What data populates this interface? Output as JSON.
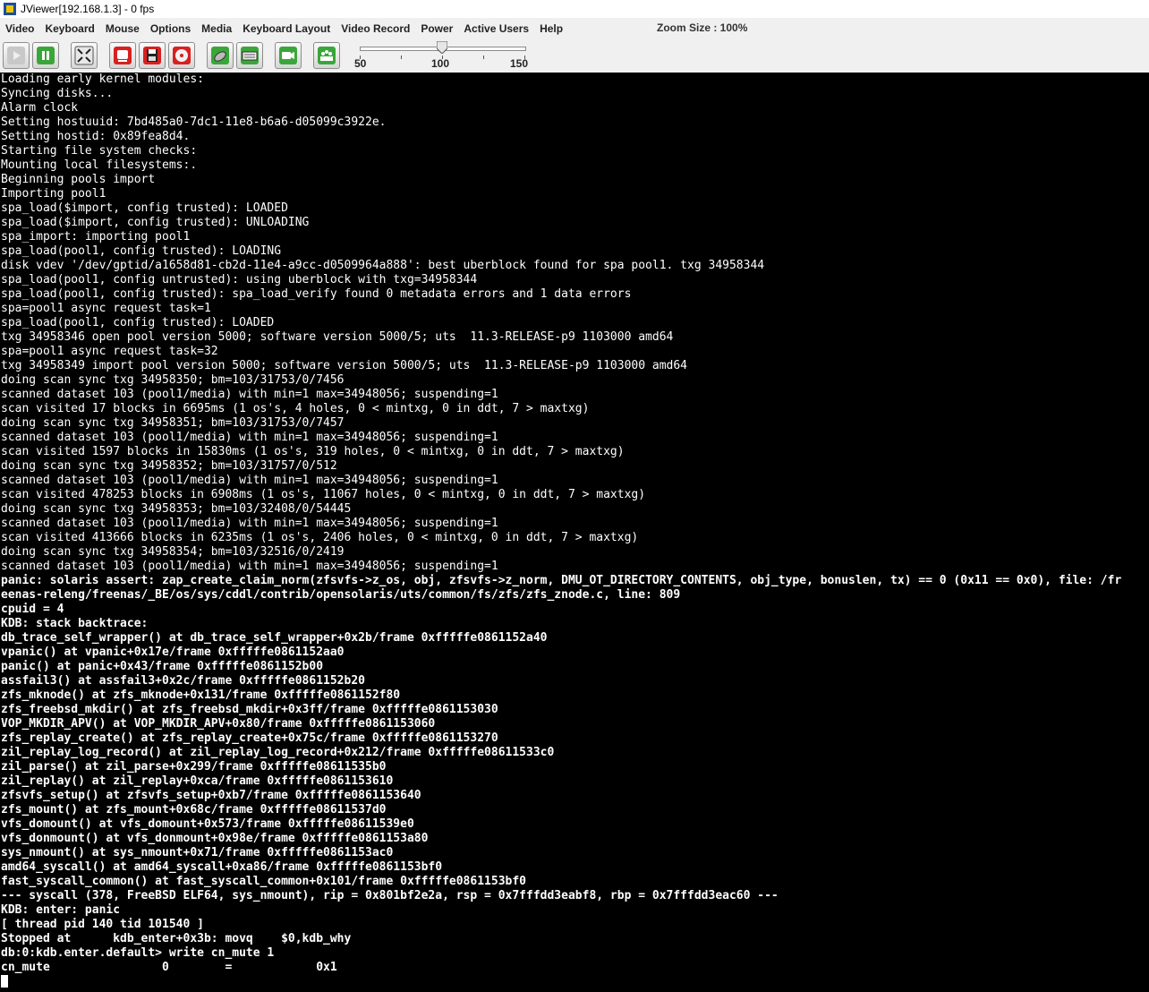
{
  "window": {
    "title": "JViewer[192.168.1.3] - 0 fps"
  },
  "menu": {
    "items": [
      "Video",
      "Keyboard",
      "Mouse",
      "Options",
      "Media",
      "Keyboard Layout",
      "Video Record",
      "Power",
      "Active Users",
      "Help"
    ],
    "zoom_label": "Zoom Size : 100%"
  },
  "toolbar": {
    "buttons": [
      {
        "name": "play-icon"
      },
      {
        "name": "pause-icon"
      },
      {
        "name": "fullscreen-icon"
      },
      {
        "name": "hard-disk-icon"
      },
      {
        "name": "floppy-icon"
      },
      {
        "name": "cdrom-icon"
      },
      {
        "name": "mouse-icon"
      },
      {
        "name": "keyboard-icon"
      },
      {
        "name": "video-record-icon"
      },
      {
        "name": "active-users-icon"
      }
    ],
    "slider": {
      "min_label": "50",
      "mid_label": "100",
      "max_label": "150",
      "value": 100,
      "min": 50,
      "max": 150
    }
  },
  "console": {
    "thin_lines": [
      "Loading early kernel modules:",
      "Syncing disks...",
      "Alarm clock",
      "Setting hostuuid: 7bd485a0-7dc1-11e8-b6a6-d05099c3922e.",
      "Setting hostid: 0x89fea8d4.",
      "Starting file system checks:",
      "Mounting local filesystems:.",
      "Beginning pools import",
      "Importing pool1",
      "spa_load($import, config trusted): LOADED",
      "spa_load($import, config trusted): UNLOADING",
      "spa_import: importing pool1",
      "spa_load(pool1, config trusted): LOADING",
      "disk vdev '/dev/gptid/a1658d81-cb2d-11e4-a9cc-d0509964a888': best uberblock found for spa pool1. txg 34958344",
      "spa_load(pool1, config untrusted): using uberblock with txg=34958344",
      "spa_load(pool1, config trusted): spa_load_verify found 0 metadata errors and 1 data errors",
      "spa=pool1 async request task=1",
      "spa_load(pool1, config trusted): LOADED",
      "txg 34958346 open pool version 5000; software version 5000/5; uts  11.3-RELEASE-p9 1103000 amd64",
      "spa=pool1 async request task=32",
      "txg 34958349 import pool version 5000; software version 5000/5; uts  11.3-RELEASE-p9 1103000 amd64",
      "doing scan sync txg 34958350; bm=103/31753/0/7456",
      "scanned dataset 103 (pool1/media) with min=1 max=34948056; suspending=1",
      "scan visited 17 blocks in 6695ms (1 os's, 4 holes, 0 < mintxg, 0 in ddt, 7 > maxtxg)",
      "doing scan sync txg 34958351; bm=103/31753/0/7457",
      "scanned dataset 103 (pool1/media) with min=1 max=34948056; suspending=1",
      "scan visited 1597 blocks in 15830ms (1 os's, 319 holes, 0 < mintxg, 0 in ddt, 7 > maxtxg)",
      "doing scan sync txg 34958352; bm=103/31757/0/512",
      "scanned dataset 103 (pool1/media) with min=1 max=34948056; suspending=1",
      "scan visited 478253 blocks in 6908ms (1 os's, 11067 holes, 0 < mintxg, 0 in ddt, 7 > maxtxg)",
      "doing scan sync txg 34958353; bm=103/32408/0/54445",
      "scanned dataset 103 (pool1/media) with min=1 max=34948056; suspending=1",
      "scan visited 413666 blocks in 6235ms (1 os's, 2406 holes, 0 < mintxg, 0 in ddt, 7 > maxtxg)",
      "doing scan sync txg 34958354; bm=103/32516/0/2419",
      "scanned dataset 103 (pool1/media) with min=1 max=34948056; suspending=1"
    ],
    "bold_lines": [
      "panic: solaris assert: zap_create_claim_norm(zfsvfs->z_os, obj, zfsvfs->z_norm, DMU_OT_DIRECTORY_CONTENTS, obj_type, bonuslen, tx) == 0 (0x11 == 0x0), file: /fr",
      "eenas-releng/freenas/_BE/os/sys/cddl/contrib/opensolaris/uts/common/fs/zfs/zfs_znode.c, line: 809",
      "cpuid = 4",
      "KDB: stack backtrace:",
      "db_trace_self_wrapper() at db_trace_self_wrapper+0x2b/frame 0xfffffe0861152a40",
      "vpanic() at vpanic+0x17e/frame 0xfffffe0861152aa0",
      "panic() at panic+0x43/frame 0xfffffe0861152b00",
      "assfail3() at assfail3+0x2c/frame 0xfffffe0861152b20",
      "zfs_mknode() at zfs_mknode+0x131/frame 0xfffffe0861152f80",
      "zfs_freebsd_mkdir() at zfs_freebsd_mkdir+0x3ff/frame 0xfffffe0861153030",
      "VOP_MKDIR_APV() at VOP_MKDIR_APV+0x80/frame 0xfffffe0861153060",
      "zfs_replay_create() at zfs_replay_create+0x75c/frame 0xfffffe0861153270",
      "zil_replay_log_record() at zil_replay_log_record+0x212/frame 0xfffffe08611533c0",
      "zil_parse() at zil_parse+0x299/frame 0xfffffe08611535b0",
      "zil_replay() at zil_replay+0xca/frame 0xfffffe0861153610",
      "zfsvfs_setup() at zfsvfs_setup+0xb7/frame 0xfffffe0861153640",
      "zfs_mount() at zfs_mount+0x68c/frame 0xfffffe08611537d0",
      "vfs_domount() at vfs_domount+0x573/frame 0xfffffe08611539e0",
      "vfs_donmount() at vfs_donmount+0x98e/frame 0xfffffe0861153a80",
      "sys_nmount() at sys_nmount+0x71/frame 0xfffffe0861153ac0",
      "amd64_syscall() at amd64_syscall+0xa86/frame 0xfffffe0861153bf0",
      "fast_syscall_common() at fast_syscall_common+0x101/frame 0xfffffe0861153bf0",
      "--- syscall (378, FreeBSD ELF64, sys_nmount), rip = 0x801bf2e2a, rsp = 0x7fffdd3eabf8, rbp = 0x7fffdd3eac60 ---",
      "KDB: enter: panic",
      "[ thread pid 140 tid 101540 ]",
      "Stopped at      kdb_enter+0x3b: movq    $0,kdb_why",
      "db:0:kdb.enter.default> write cn_mute 1",
      "cn_mute                0        =            0x1"
    ]
  }
}
